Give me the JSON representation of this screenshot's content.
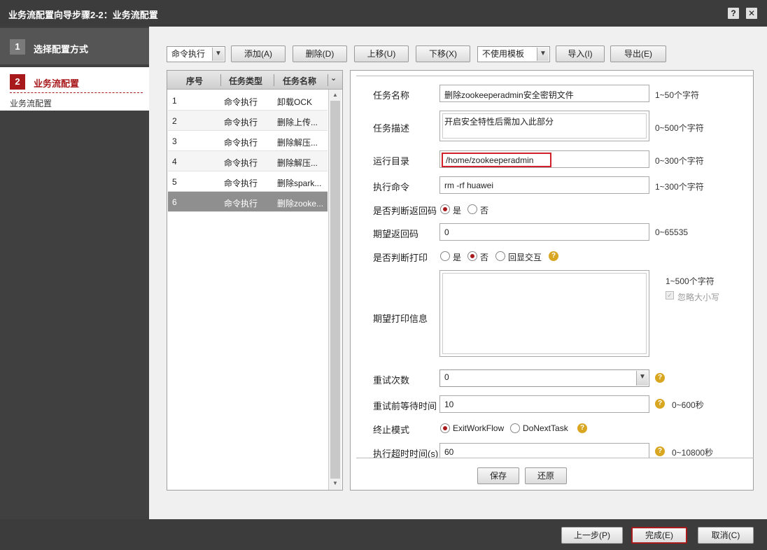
{
  "window": {
    "title": "业务流配置向导步骤2-2：业务流配置",
    "help_label": "?",
    "close_label": "✕"
  },
  "sidebar": {
    "step1": {
      "num": "1",
      "label": "选择配置方式"
    },
    "step2": {
      "num": "2",
      "label": "业务流配置",
      "sub": "业务流配置"
    }
  },
  "toolbar": {
    "type_select": "命令执行",
    "add": "添加(A)",
    "delete": "删除(D)",
    "up": "上移(U)",
    "down": "下移(X)",
    "template_select": "不使用模板",
    "import": "导入(I)",
    "export": "导出(E)"
  },
  "task_list": {
    "headers": [
      "序号",
      "任务类型",
      "任务名称"
    ],
    "rows": [
      {
        "no": "1",
        "type": "命令执行",
        "name": "卸载OCK"
      },
      {
        "no": "2",
        "type": "命令执行",
        "name": "删除上传..."
      },
      {
        "no": "3",
        "type": "命令执行",
        "name": "删除解压..."
      },
      {
        "no": "4",
        "type": "命令执行",
        "name": "删除解压..."
      },
      {
        "no": "5",
        "type": "命令执行",
        "name": "删除spark..."
      },
      {
        "no": "6",
        "type": "命令执行",
        "name": "删除zooke..."
      }
    ],
    "selected_row": "6"
  },
  "form": {
    "task_name": {
      "label": "任务名称",
      "value": "删除zookeeperadmin安全密钥文件",
      "hint": "1~50个字符"
    },
    "task_desc": {
      "label": "任务描述",
      "value": "开启安全特性后需加入此部分",
      "hint": "0~500个字符"
    },
    "run_dir": {
      "label": "运行目录",
      "value": "/home/zookeeperadmin",
      "hint": "0~300个字符"
    },
    "command": {
      "label": "执行命令",
      "value": "rm -rf huawei",
      "hint": "1~300个字符"
    },
    "check_return": {
      "label": "是否判断返回码",
      "yes": "是",
      "no": "否"
    },
    "expected_code": {
      "label": "期望返回码",
      "value": "0",
      "hint": "0~65535"
    },
    "check_print": {
      "label": "是否判断打印",
      "yes": "是",
      "no": "否",
      "echo": "回显交互"
    },
    "expected_print": {
      "label": "期望打印信息",
      "value": "",
      "hint": "1~500个字符",
      "ignore_case": "忽略大小写"
    },
    "retry_count": {
      "label": "重试次数",
      "value": "0"
    },
    "retry_wait": {
      "label": "重试前等待时间",
      "value": "10",
      "hint": "0~600秒"
    },
    "stop_mode": {
      "label": "终止模式",
      "opt1": "ExitWorkFlow",
      "opt2": "DoNextTask"
    },
    "timeout": {
      "label": "执行超时时间(s)",
      "value": "60",
      "hint": "0~10800秒"
    },
    "save": "保存",
    "restore": "还原"
  },
  "footer": {
    "prev": "上一步(P)",
    "finish": "完成(E)",
    "cancel": "取消(C)"
  },
  "colors": {
    "accent": "#a8191c",
    "help": "#d9a621"
  }
}
